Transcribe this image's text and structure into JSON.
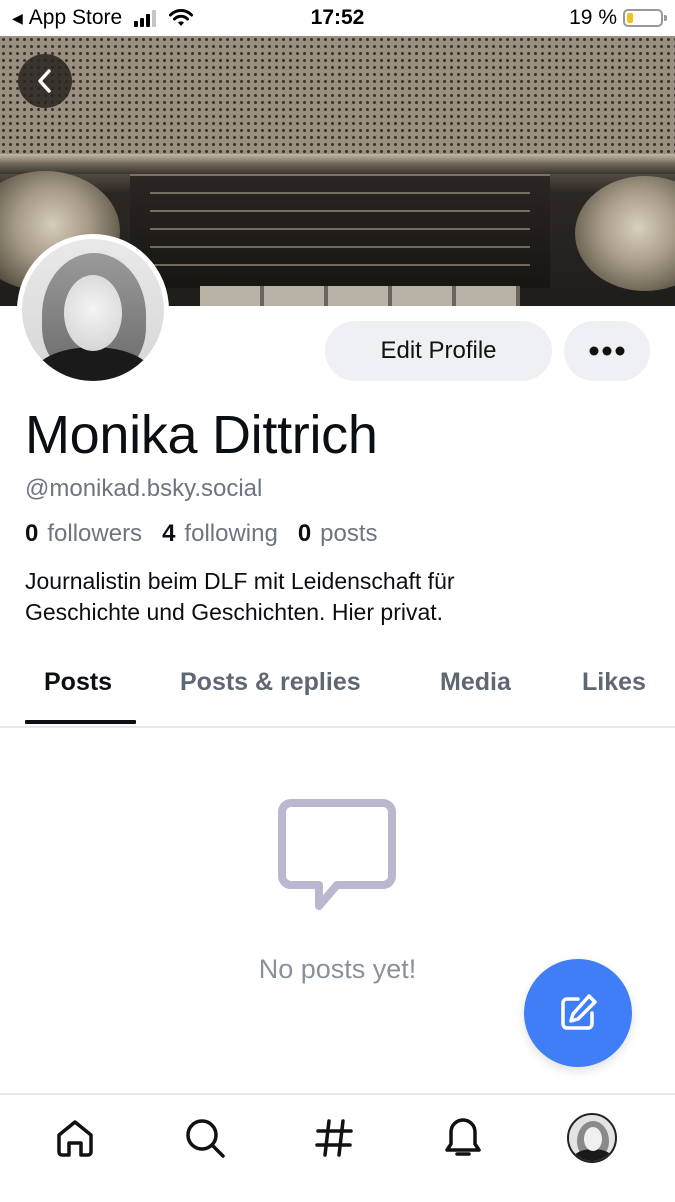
{
  "status_bar": {
    "back_app": "App Store",
    "time": "17:52",
    "battery_text": "19 %",
    "battery_level": 0.19,
    "signal_bars": 3
  },
  "banner": {
    "back_icon": "chevron-left-icon"
  },
  "profile": {
    "edit_label": "Edit Profile",
    "more_icon": "ellipsis-icon",
    "display_name": "Monika Dittrich",
    "handle": "@monikad.bsky.social",
    "stats": {
      "followers_count": "0",
      "followers_label": "followers",
      "following_count": "4",
      "following_label": "following",
      "posts_count": "0",
      "posts_label": "posts"
    },
    "bio_line1": "Journalistin beim DLF mit Leidenschaft für",
    "bio_line2": "Geschichte und Geschichten. Hier privat."
  },
  "tabs": [
    {
      "label": "Posts",
      "active": true
    },
    {
      "label": "Posts & replies",
      "active": false
    },
    {
      "label": "Media",
      "active": false
    },
    {
      "label": "Likes",
      "active": false
    }
  ],
  "empty_state": {
    "icon": "message-bubble-icon",
    "text": "No posts yet!"
  },
  "fab": {
    "icon": "compose-icon",
    "color": "#3f7ef7"
  },
  "bottom_nav": [
    {
      "name": "home",
      "icon": "home-icon"
    },
    {
      "name": "search",
      "icon": "search-icon"
    },
    {
      "name": "feeds",
      "icon": "hashtag-icon"
    },
    {
      "name": "notifications",
      "icon": "bell-icon"
    },
    {
      "name": "profile",
      "icon": "avatar"
    }
  ]
}
